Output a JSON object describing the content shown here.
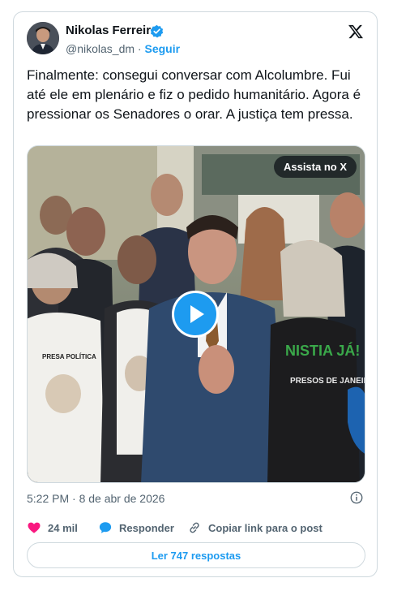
{
  "author": {
    "name": "Nikolas Ferreira",
    "handle": "@nikolas_dm",
    "separator": "·",
    "follow_label": "Seguir"
  },
  "tweet": {
    "text": "Finalmente: consegui conversar com Alcolumbre. Fui até ele em plenário e fiz o pedido humanitário. Agora é pressionar os Senadores o orar. A justiça tem pressa.",
    "timestamp": "5:22 PM · 8 de abr de 2026"
  },
  "media": {
    "watch_label": "Assista no X",
    "shirt_text": "PRESA POLÍTICA",
    "banner_text": "NISTIA JÁ!",
    "banner_sub": "PRESOS DE JANEIRO"
  },
  "actions": {
    "likes": "24 mil",
    "reply_label": "Responder",
    "copy_label": "Copiar link para o post"
  },
  "replies": {
    "label": "Ler 747 respostas"
  },
  "colors": {
    "accent": "#1d9bf0",
    "like": "#f91880",
    "muted": "#536471",
    "border": "#cfd9de"
  },
  "icons": [
    "verified-badge-icon",
    "x-logo-icon",
    "play-icon",
    "info-icon",
    "heart-icon",
    "reply-bubble-icon",
    "link-icon"
  ]
}
